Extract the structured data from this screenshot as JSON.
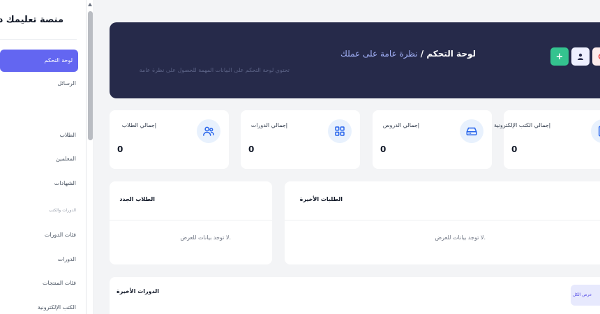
{
  "sidebar": {
    "brand": "منصة تعليمك دوما",
    "items": [
      {
        "label": "لوحة التحكم",
        "active": true
      },
      {
        "label": "الرسائل"
      },
      {
        "label": "الطلاب"
      },
      {
        "label": "المعلمين"
      },
      {
        "label": "الشهادات"
      },
      {
        "label": "فئات الدورات"
      },
      {
        "label": "الدورات"
      },
      {
        "label": "فئات المنتجات"
      },
      {
        "label": "الكتب الإلكترونية"
      }
    ],
    "section_label": "الدورات والكتب"
  },
  "header": {
    "title": "لوحة التحكم",
    "separator": " / ",
    "crumb": "نظرة عامة على عملك",
    "subtitle": "تحتوي لوحة التحكم على البيانات المهمة للحصول على نظرة عامة",
    "buttons": {
      "add": "+",
      "user_icon": "user-icon",
      "red_icon": "circle-icon"
    }
  },
  "stats": [
    {
      "label": "إجمالي الطلاب",
      "value": "0",
      "icon": "users-icon"
    },
    {
      "label": "إجمالي الدورات",
      "value": "0",
      "icon": "grid-icon"
    },
    {
      "label": "إجمالي الدروس",
      "value": "0",
      "icon": "drive-icon"
    },
    {
      "label": "إجمالي الكتب الإلكترونية",
      "value": "0",
      "icon": "book-icon"
    }
  ],
  "panels": {
    "new_students": {
      "title": "الطلاب الجدد",
      "empty": ".لا توجد بيانات للعرض"
    },
    "recent_orders": {
      "title": "الطلبات الأخيرة",
      "empty": ".لا توجد بيانات للعرض"
    },
    "recent_courses": {
      "title": "الدورات الأخيرة",
      "view_all": "عرض الكل"
    }
  },
  "colors": {
    "accent": "#6366f1",
    "hero": "#262a4a",
    "success": "#34c38f",
    "danger": "#ef4444",
    "icon_blue": "#2563eb"
  }
}
